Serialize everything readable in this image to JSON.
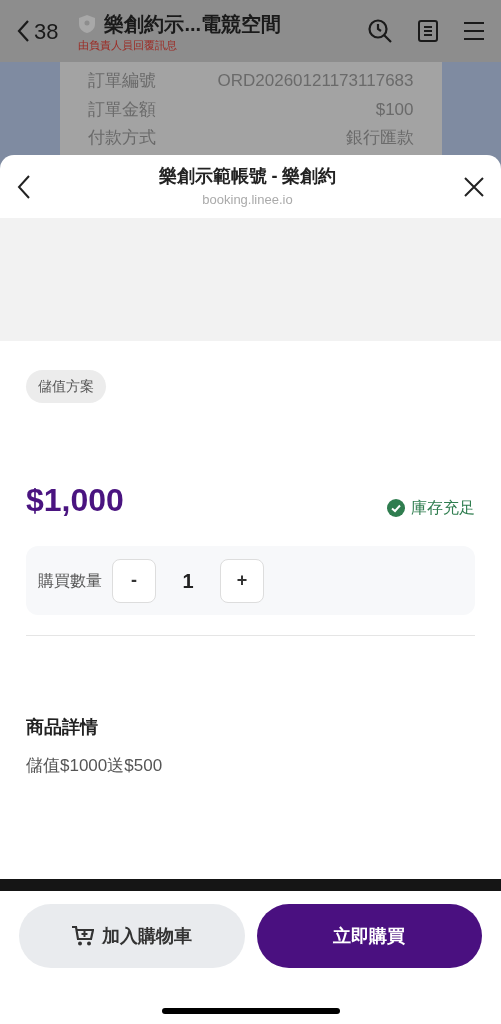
{
  "chat_header": {
    "back_count": "38",
    "title": "樂創約示...電競空間",
    "subtitle": "由負責人員回覆訊息"
  },
  "order_card": {
    "rows": [
      {
        "label": "訂單編號",
        "value": "ORD20260121173117683"
      },
      {
        "label": "訂單金額",
        "value": "$100"
      },
      {
        "label": "付款方式",
        "value": "銀行匯款"
      }
    ]
  },
  "sheet": {
    "title": "樂創示範帳號 - 樂創約",
    "url": "booking.linee.io"
  },
  "product": {
    "tag": "儲值方案",
    "price": "$1,000",
    "stock_status": "庫存充足",
    "quantity_label": "購買數量",
    "decrease": "-",
    "quantity": "1",
    "increase": "+",
    "details_title": "商品詳情",
    "details": "儲值$1000送$500"
  },
  "buttons": [
    {
      "kind": "cart",
      "label": "加入購物車"
    },
    {
      "kind": "buy",
      "label": "立即購買"
    }
  ]
}
